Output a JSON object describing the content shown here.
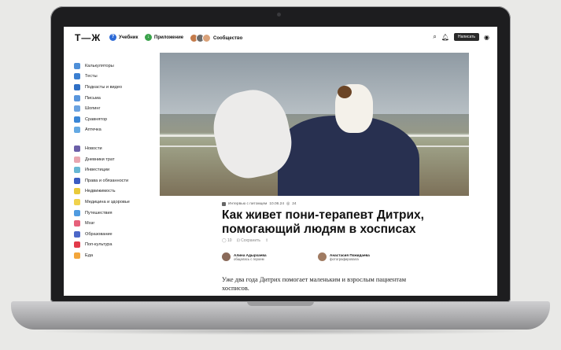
{
  "header": {
    "logo": "Т—Ж",
    "nav": [
      {
        "label": "Учебник",
        "icon": "book-icon",
        "color": "#2d6ad6"
      },
      {
        "label": "Приложение",
        "icon": "download-icon",
        "color": "#39a24a"
      },
      {
        "label": "Сообщество",
        "icon": "avatars-icon",
        "color": "#c47b4b"
      }
    ],
    "write_label": "Написать"
  },
  "sidebar": {
    "group1": [
      {
        "label": "Калькуляторы",
        "color": "#4e8fd8"
      },
      {
        "label": "Тесты",
        "color": "#3b7fd1"
      },
      {
        "label": "Подкасты и видео",
        "color": "#2f6fc5"
      },
      {
        "label": "Письма",
        "color": "#5895dc"
      },
      {
        "label": "Шопинг",
        "color": "#6aa2e0"
      },
      {
        "label": "Сравнятор",
        "color": "#3a86d6"
      },
      {
        "label": "Аптечка",
        "color": "#64a9e3"
      }
    ],
    "group2": [
      {
        "label": "Новости",
        "color": "#6b5fa8"
      },
      {
        "label": "Дневники трат",
        "color": "#e8a6b0"
      },
      {
        "label": "Инвестиции",
        "color": "#67b7d4"
      },
      {
        "label": "Права и обязанности",
        "color": "#3a5cc2"
      },
      {
        "label": "Недвижимость",
        "color": "#e8c93a"
      },
      {
        "label": "Медицина и здоровье",
        "color": "#f0d24c"
      },
      {
        "label": "Путешествия",
        "color": "#4f9be0"
      },
      {
        "label": "Мозг",
        "color": "#e6607a"
      },
      {
        "label": "Образование",
        "color": "#4c67c8"
      },
      {
        "label": "Поп-культура",
        "color": "#e23a4a"
      },
      {
        "label": "Еда",
        "color": "#f3a63c"
      }
    ]
  },
  "article": {
    "category": "Интервью с питомцем",
    "date": "10.06.24",
    "views": "24",
    "title": "Как живет пони-терапевт Дитрих, помогающий людям в хосписах",
    "comments": "10",
    "save_label": "Сохранить",
    "authors": [
      {
        "name": "Алина Адырхаева",
        "role": "общалась с героем",
        "color": "#8a6a5a"
      },
      {
        "name": "Анастасия Пожидаева",
        "role": "фотографировала",
        "color": "#a07b62"
      }
    ],
    "lead": "Уже два года Дитрих помогает маленьким и взрослым пациентам хосписов."
  }
}
